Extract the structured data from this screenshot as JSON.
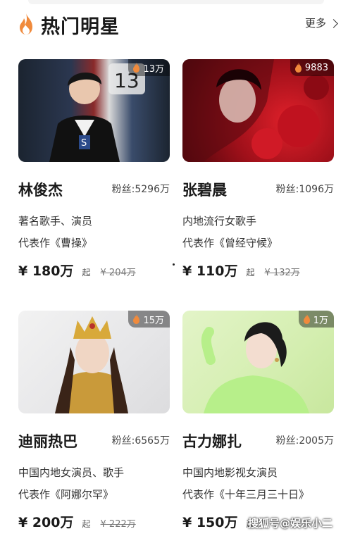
{
  "section": {
    "title": "热门明星",
    "more_label": "更多"
  },
  "accent_color": "#f08a3c",
  "cards": [
    {
      "hot": "13万",
      "name": "林俊杰",
      "fans": "粉丝:5296万",
      "desc": "著名歌手、演员",
      "works": "代表作《曹操》",
      "price": "¥ 180万",
      "qi": "起",
      "old_price": "¥ 204万"
    },
    {
      "hot": "9883",
      "name": "张碧晨",
      "fans": "粉丝:1096万",
      "desc": "内地流行女歌手",
      "works": "代表作《曾经守候》",
      "price": "¥ 110万",
      "qi": "起",
      "old_price": "¥ 132万"
    },
    {
      "hot": "15万",
      "name": "迪丽热巴",
      "fans": "粉丝:6565万",
      "desc": "中国内地女演员、歌手",
      "works": "代表作《阿娜尔罕》",
      "price": "¥ 200万",
      "qi": "起",
      "old_price": "¥ 222万"
    },
    {
      "hot": "1万",
      "name": "古力娜扎",
      "fans": "粉丝:2005万",
      "desc": "中国内地影视女演员",
      "works": "代表作《十年三月三十日》",
      "price": "¥ 150万",
      "qi": "起",
      "old_price": ""
    }
  ],
  "watermark": "搜狐号@娱乐小二",
  "icons": [
    "flame-icon",
    "chevron-right-icon"
  ]
}
